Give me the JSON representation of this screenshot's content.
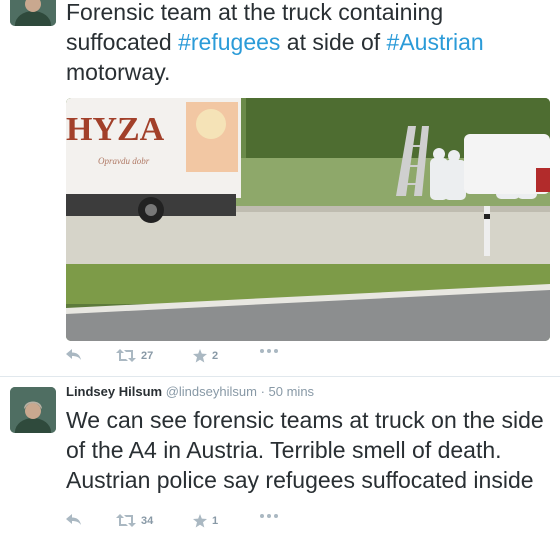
{
  "tweets": [
    {
      "text_segments": [
        {
          "text": "Forensic team at the truck containing suffocated ",
          "hashtag": false
        },
        {
          "text": "#refugees",
          "hashtag": true
        },
        {
          "text": " at side of ",
          "hashtag": false
        },
        {
          "text": "#Austrian",
          "hashtag": true
        },
        {
          "text": " motorway.",
          "hashtag": false
        }
      ],
      "media": {
        "truck_brand": "HYZA",
        "truck_subtitle": "Opravdu dobr"
      },
      "actions": {
        "retweets": "27",
        "favorites": "2"
      }
    },
    {
      "author_name": "Lindsey Hilsum",
      "handle": "@lindseyhilsum",
      "separator": "·",
      "time": "50 mins",
      "text": "We can see forensic teams at truck on the side of the A4 in Austria. Terrible smell of death. Austrian police say refugees suffocated inside",
      "actions": {
        "retweets": "34",
        "favorites": "1"
      }
    }
  ],
  "colors": {
    "hashtag": "#2b9bd8",
    "text": "#292f33",
    "meta": "#8899a6"
  },
  "icons": [
    "reply-icon",
    "retweet-icon",
    "favorite-star-icon",
    "more-ellipsis-icon"
  ]
}
